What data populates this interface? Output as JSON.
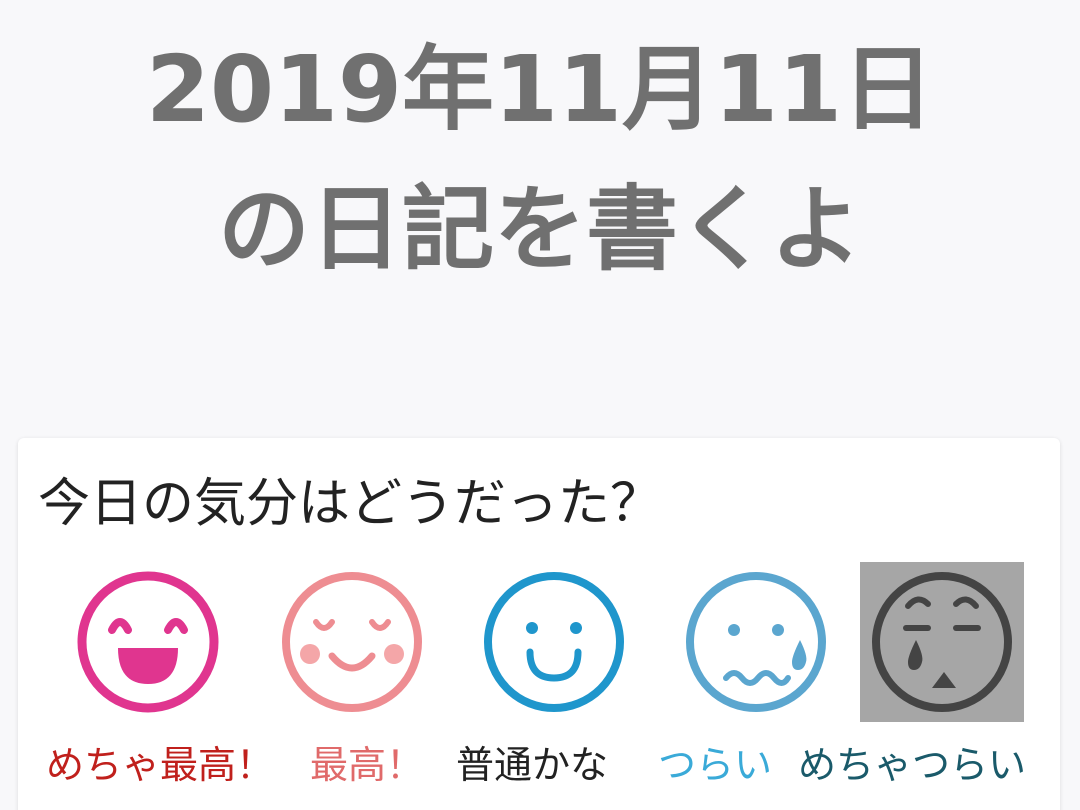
{
  "header": {
    "title_line1": "2019年11月11日",
    "title_line2": "の日記を書くよ"
  },
  "mood_card": {
    "question": "今日の気分はどうだった？",
    "selected_index": 4,
    "options": [
      {
        "label": "めちゃ最高！",
        "label_color": "#c0201c",
        "icon": "very-happy-face-icon",
        "icon_color": "#e0358f"
      },
      {
        "label": "最高！",
        "label_color": "#e06a6a",
        "icon": "happy-face-icon",
        "icon_color": "#ee8d92"
      },
      {
        "label": "普通かな",
        "label_color": "#222222",
        "icon": "neutral-face-icon",
        "icon_color": "#1f96cc"
      },
      {
        "label": "つらい",
        "label_color": "#3aaad8",
        "icon": "sad-face-icon",
        "icon_color": "#5ba6cf"
      },
      {
        "label": "めちゃつらい",
        "label_color": "#1a5a6a",
        "icon": "very-sad-face-icon",
        "icon_color": "#444444"
      }
    ]
  }
}
